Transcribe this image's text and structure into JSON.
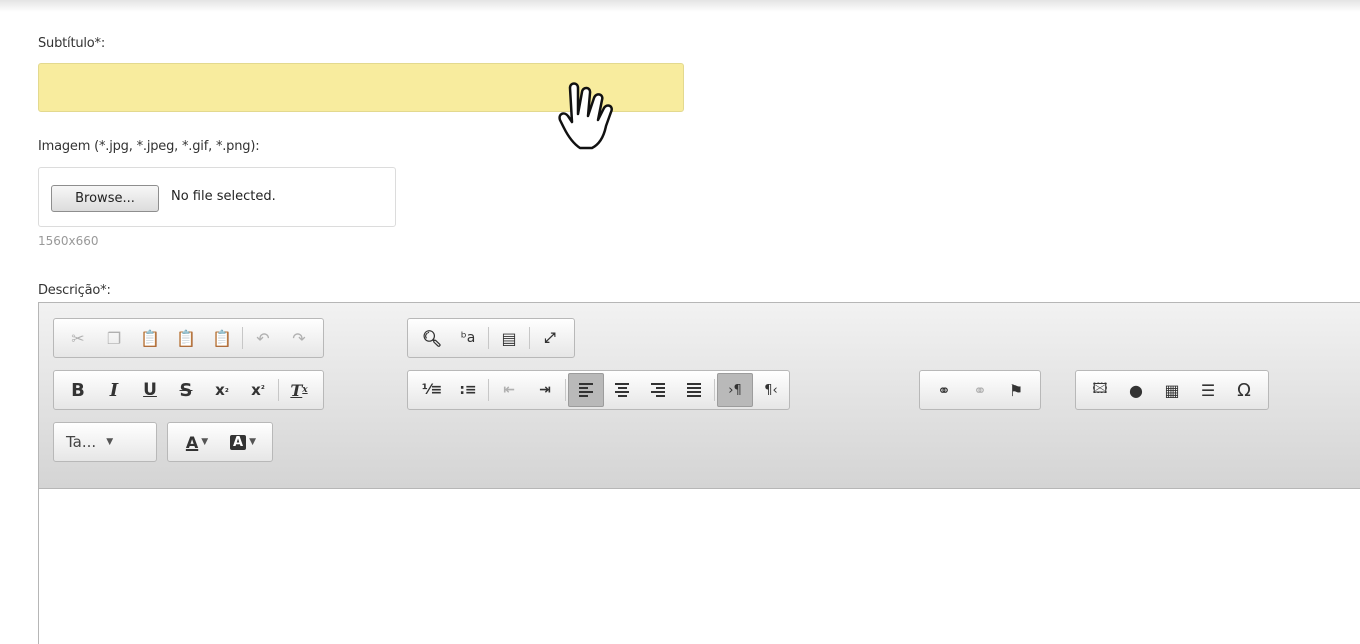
{
  "form": {
    "subtitle_label": "Subtítulo*:",
    "subtitle_value": "",
    "image_label": "Imagem (*.jpg, *.jpeg, *.gif, *.png):",
    "browse_label": "Browse...",
    "file_status": "No file selected.",
    "image_hint": "1560x660",
    "description_label": "Descrição*:"
  },
  "editor": {
    "row1": [
      "cut",
      "copy",
      "paste",
      "paste-as-text",
      "paste-from-word",
      "undo",
      "redo",
      "find",
      "replace",
      "select-all",
      "maximize"
    ],
    "row2": [
      "bold",
      "italic",
      "underline",
      "strike",
      "subscript",
      "superscript",
      "remove-format",
      "numbered-list",
      "bulleted-list",
      "outdent",
      "indent",
      "align-left",
      "align-center",
      "align-right",
      "justify",
      "ltr",
      "rtl",
      "link",
      "unlink",
      "anchor",
      "image",
      "flash",
      "table",
      "horizontal-rule",
      "special-char"
    ],
    "format_combo": "Ta...",
    "text_color_label": "A",
    "bg_color_label": "A",
    "active": [
      "align-left",
      "ltr"
    ]
  },
  "colors": {
    "subtitle_bg": "#f8ec9e",
    "toolbar_bg": "#e0e0e0"
  }
}
